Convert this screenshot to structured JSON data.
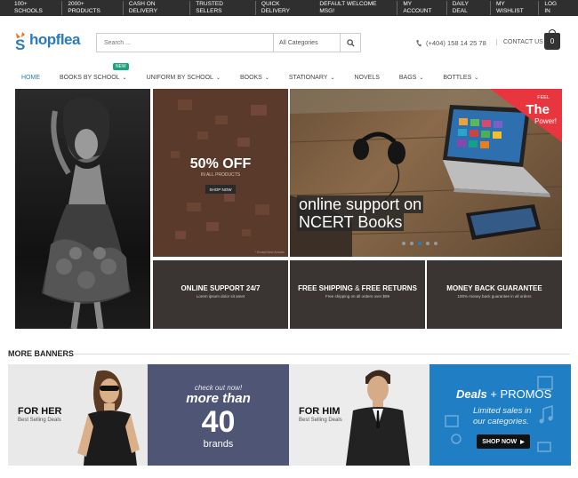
{
  "topbar": {
    "left": [
      "100+ Schools",
      "2000+ Products",
      "Cash on delivery",
      "Trusted Sellers",
      "Quick Delivery"
    ],
    "right": [
      "Default welcome msg!",
      "My Account",
      "Daily Deal",
      "My Wishlist",
      "Log In"
    ]
  },
  "header": {
    "logo_text": "hopflea",
    "logo_initial": "S",
    "search_placeholder": "Search ...",
    "category": "All Categories",
    "phone": "(+404) 158 14 25 78",
    "contact": "Contact Us",
    "cart_count": "0"
  },
  "nav": {
    "items": [
      "Home",
      "Books By School",
      "Uniform By School",
      "Books",
      "Stationary",
      "Novels",
      "Bags",
      "Bottles"
    ],
    "new_badge": "New"
  },
  "banners": {
    "sale_pct": "50% OFF",
    "sale_sub": "In all products",
    "sale_btn": "Shop Now",
    "sale_note": "* Except New Arrivals",
    "slider_line1": "online support on",
    "slider_line2": "NCERT Books",
    "slider_corner1": "Feel",
    "slider_corner2": "The",
    "slider_corner3": "Power!",
    "tiles": [
      {
        "title": "Online Support 24/7",
        "sub": "Lorem ipsum dolor sit amet"
      },
      {
        "title_a": "Free Shipping",
        "title_amp": " & ",
        "title_b": "Free Returns",
        "sub": "Free shipping on all orders over $99"
      },
      {
        "title": "Money Back Guarantee",
        "sub": "100% money back guarantee in all orders"
      }
    ]
  },
  "more": {
    "title": "More Banners",
    "her": "For Her",
    "her_sub": "Best Selling Deals",
    "brands_l1": "check out now!",
    "brands_l2": "more than",
    "brands_num": "40",
    "brands_l3": "brands",
    "him": "For Him",
    "him_sub": "Best Selling Deals",
    "promo_a": "Deals",
    "promo_b": " + PROMOS",
    "promo_l1": "Limited sales in",
    "promo_l2": "our categories.",
    "promo_btn": "Shop Now"
  },
  "colors": {
    "accent": "#2b7bbd",
    "topbar": "#2f2f2f",
    "new": "#1ba37e",
    "promo": "#1f7ec4",
    "brands": "#4f5574",
    "corner": "#e8363f"
  }
}
